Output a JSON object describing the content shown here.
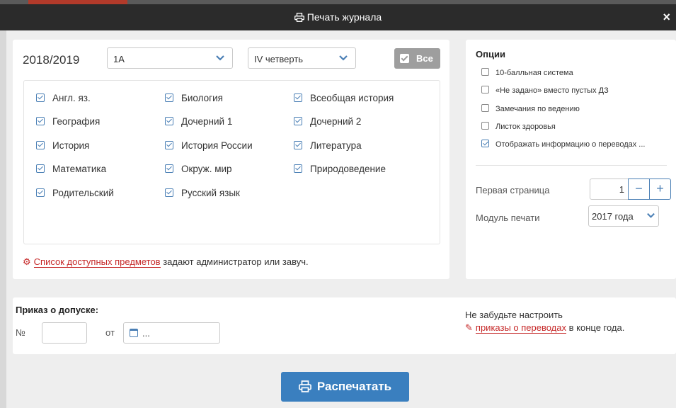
{
  "dialog": {
    "title": "Печать журнала",
    "close_label": "×"
  },
  "filters": {
    "year": "2018/2019",
    "class_value": "1А",
    "quarter_value": "IV четверть",
    "all_label": "Все"
  },
  "subjects": [
    {
      "label": "Англ. яз.",
      "checked": true
    },
    {
      "label": "Биология",
      "checked": true
    },
    {
      "label": "Всеобщая история",
      "checked": true
    },
    {
      "label": "География",
      "checked": true
    },
    {
      "label": "Дочерний 1",
      "checked": true
    },
    {
      "label": "Дочерний 2",
      "checked": true
    },
    {
      "label": "История",
      "checked": true
    },
    {
      "label": "История России",
      "checked": true
    },
    {
      "label": "Литература",
      "checked": true
    },
    {
      "label": "Математика",
      "checked": true
    },
    {
      "label": "Окруж. мир",
      "checked": true
    },
    {
      "label": "Природоведение",
      "checked": true
    },
    {
      "label": "Родительский",
      "checked": true
    },
    {
      "label": "Русский язык",
      "checked": true
    }
  ],
  "note": {
    "link": "Список доступных предметов",
    "rest": " задают администратор или завуч."
  },
  "options": {
    "title": "Опции",
    "items": [
      {
        "label": "10-балльная система",
        "checked": false
      },
      {
        "label": "«Не задано» вместо пустых ДЗ",
        "checked": false
      },
      {
        "label": "Замечания по ведению",
        "checked": false
      },
      {
        "label": "Листок здоровья",
        "checked": false
      },
      {
        "label": "Отображать информацию о переводах ...",
        "checked": true
      }
    ],
    "first_page_label": "Первая страница",
    "first_page_value": "1",
    "minus": "−",
    "plus": "+",
    "module_label": "Модуль печати",
    "module_value": "2017 года"
  },
  "order": {
    "title": "Приказ о допуске:",
    "num_label": "№",
    "from_label": "от",
    "date_placeholder": "...",
    "reminder_line1": "Не забудьте настроить",
    "reminder_link": "приказы о переводах",
    "reminder_rest": " в конце года."
  },
  "print_button": "Распечатать",
  "colors": {
    "accent": "#3a7fbf",
    "link": "#c62828",
    "titlebar": "#2b2b2b"
  }
}
